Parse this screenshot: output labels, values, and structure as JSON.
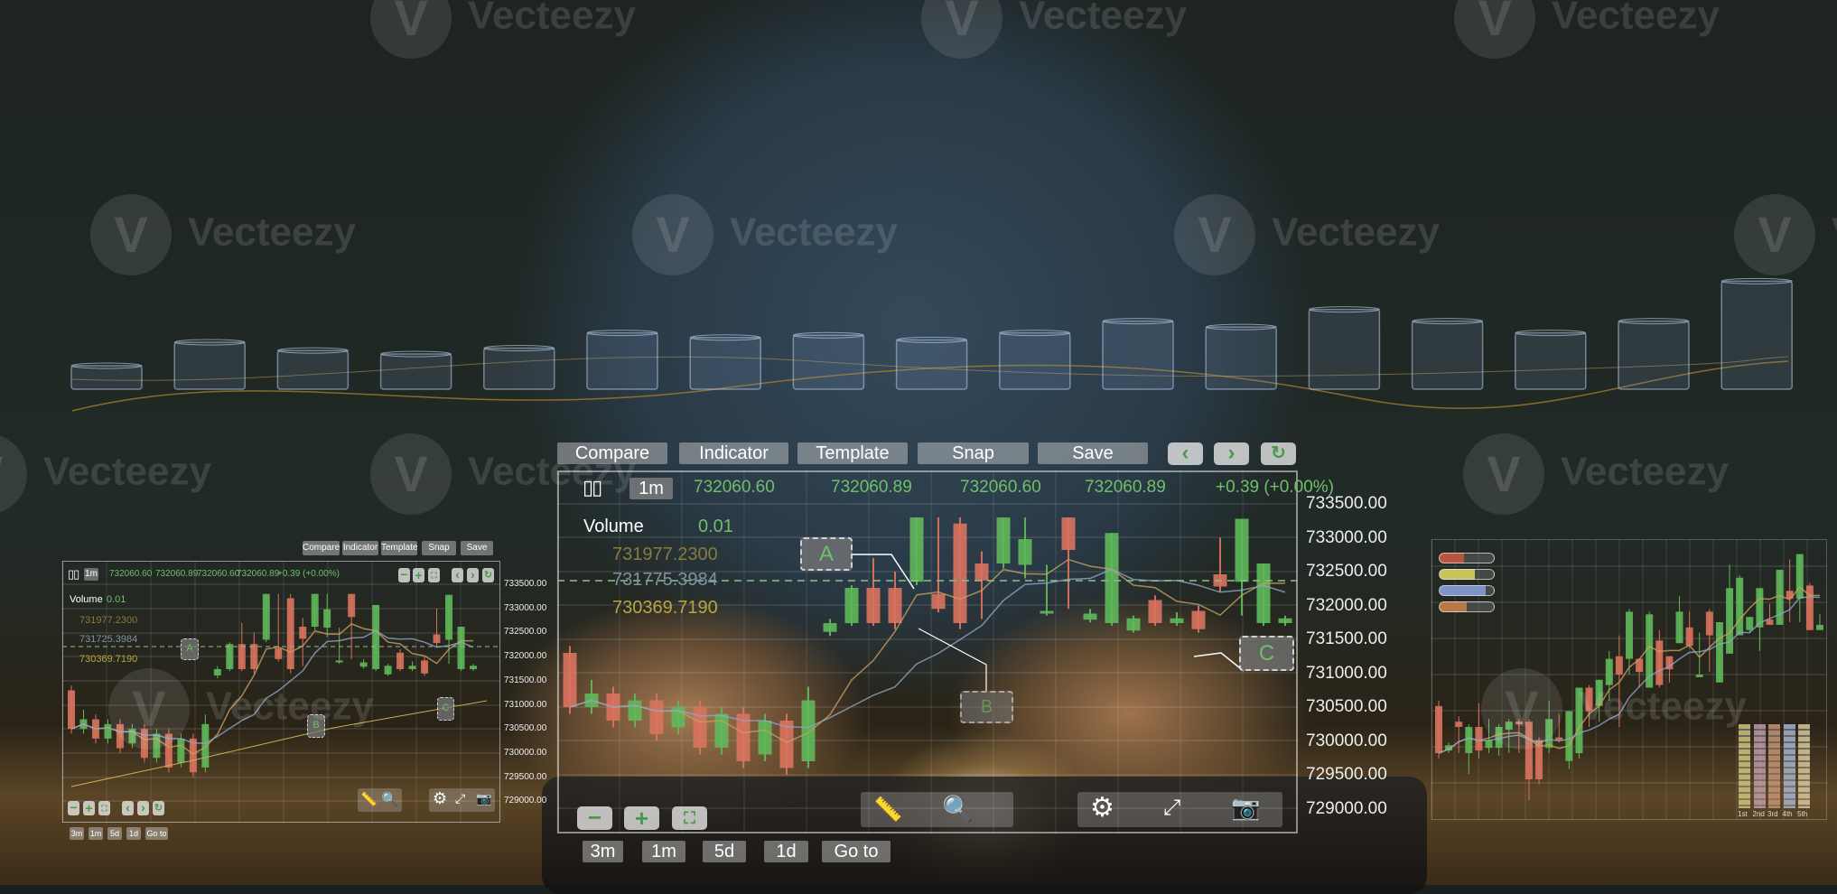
{
  "watermark": "Vecteezy",
  "colors": {
    "up": "#5fb85a",
    "down": "#d9735e",
    "ma1": "#c9a060",
    "ma2": "#8fa6c8",
    "price_text": "#6fbf6a"
  },
  "volume_cylinders": [
    20,
    40,
    33,
    30,
    35,
    48,
    44,
    46,
    42,
    48,
    58,
    53,
    68,
    58,
    48,
    58,
    92
  ],
  "main": {
    "toolbar": [
      "Compare",
      "Indicator",
      "Template",
      "Snap",
      "Save"
    ],
    "nav": {
      "prev": "‹",
      "next": "›",
      "refresh": "↻"
    },
    "interval": "1m",
    "ohlc": [
      "732060.60",
      "732060.89",
      "732060.60",
      "732060.89",
      "+0.39 (+0.00%)"
    ],
    "volume_label": "Volume",
    "volume_value": "0.01",
    "levels": [
      "731977.2300",
      "731775.3984",
      "730369.7190"
    ],
    "markers": [
      "A",
      "B",
      "C"
    ],
    "zoom": {
      "minus": "−",
      "plus": "+",
      "fit": "⛶"
    },
    "timeframes": [
      "3m",
      "1m",
      "5d",
      "1d",
      "Go to"
    ]
  },
  "small": {
    "toolbar": [
      "Compare",
      "Indicator",
      "Template",
      "Snap",
      "Save"
    ],
    "interval": "1m",
    "ohlc": [
      "732060.60",
      "732060.89",
      "732060.60",
      "732060.89",
      "+0.39 (+0.00%)"
    ],
    "volume_label": "Volume",
    "volume_value": "0.01",
    "levels": [
      "731977.2300",
      "731725.3984",
      "730369.7190"
    ],
    "markers": [
      "A",
      "B",
      "C"
    ],
    "timeframes": [
      "3m",
      "1m",
      "5d",
      "1d",
      "Go to"
    ]
  },
  "right": {
    "rank_labels": [
      "1st",
      "2nd",
      "3rd",
      "4th",
      "5th"
    ]
  },
  "chart_data": {
    "type": "candlestick",
    "y_ticks": [
      "733500.00",
      "733000.00",
      "732500.00",
      "732000.00",
      "731500.00",
      "731000.00",
      "730500.00",
      "730000.00",
      "729500.00",
      "729000.00"
    ],
    "ylim": [
      729000,
      733500
    ],
    "candles_ohlc": [
      [
        731300,
        730500,
        731400,
        730400
      ],
      [
        730500,
        730700,
        730900,
        730400
      ],
      [
        730700,
        730300,
        730800,
        730200
      ],
      [
        730300,
        730600,
        730700,
        730200
      ],
      [
        730600,
        730100,
        730700,
        730000
      ],
      [
        730200,
        730500,
        730600,
        730100
      ],
      [
        730500,
        729900,
        730600,
        729800
      ],
      [
        729900,
        730400,
        730500,
        729800
      ],
      [
        730400,
        729700,
        730500,
        729600
      ],
      [
        729800,
        730300,
        730400,
        729700
      ],
      [
        730300,
        729600,
        730400,
        729500
      ],
      [
        729700,
        730600,
        730800,
        729600
      ],
      [
        731610,
        731740,
        731800,
        731550
      ],
      [
        731740,
        732260,
        732300,
        731700
      ],
      [
        732260,
        731740,
        732700,
        731700
      ],
      [
        732260,
        731740,
        732500,
        731650
      ],
      [
        732350,
        733300,
        733300,
        732300
      ],
      [
        732170,
        731950,
        733300,
        731900
      ],
      [
        733210,
        731740,
        733300,
        731650
      ],
      [
        732620,
        732370,
        732800,
        731800
      ],
      [
        732620,
        733300,
        733300,
        732550
      ],
      [
        732600,
        732980,
        733300,
        732400
      ],
      [
        731880,
        731920,
        732600,
        731850
      ],
      [
        733300,
        732820,
        733300,
        731950
      ],
      [
        731790,
        731880,
        731950,
        731750
      ],
      [
        731740,
        733070,
        733070,
        731700
      ],
      [
        731630,
        731810,
        731850,
        731600
      ],
      [
        732080,
        731740,
        732150,
        731700
      ],
      [
        731740,
        731810,
        731900,
        731700
      ],
      [
        731920,
        731650,
        732000,
        731600
      ],
      [
        732460,
        732280,
        733000,
        732200
      ],
      [
        732350,
        733280,
        733280,
        731850
      ],
      [
        731740,
        732620,
        732620,
        731700
      ],
      [
        731740,
        731810,
        731850,
        731700
      ]
    ]
  },
  "right_chart": {
    "candles": [
      [
        38,
        20,
        40,
        18
      ],
      [
        21,
        23,
        24,
        20
      ],
      [
        32,
        30,
        34,
        20
      ],
      [
        20,
        30,
        31,
        12
      ],
      [
        30,
        21,
        39,
        18
      ],
      [
        22,
        25,
        33,
        20
      ],
      [
        22,
        30,
        31,
        19
      ],
      [
        29,
        32,
        33,
        20
      ],
      [
        32,
        31,
        33,
        20
      ],
      [
        32,
        10,
        33,
        2
      ],
      [
        25,
        10,
        26,
        8
      ],
      [
        22,
        33,
        40,
        20
      ],
      [
        26,
        25,
        35,
        24
      ],
      [
        17,
        36,
        36,
        14
      ],
      [
        20,
        45,
        45,
        18
      ],
      [
        45,
        36,
        46,
        30
      ],
      [
        38,
        48,
        48,
        32
      ],
      [
        46,
        56,
        59,
        40
      ],
      [
        57,
        50,
        65,
        30
      ],
      [
        56,
        74,
        75,
        50
      ],
      [
        56,
        51,
        56,
        45
      ],
      [
        45,
        73,
        74,
        45
      ],
      [
        63,
        46,
        67,
        45
      ],
      [
        57,
        52,
        57,
        47
      ],
      [
        62,
        74,
        80,
        62
      ],
      [
        68,
        61,
        74,
        60
      ],
      [
        49,
        50,
        66,
        49
      ],
      [
        74,
        65,
        75,
        51
      ],
      [
        47,
        70,
        70,
        47
      ],
      [
        58,
        83,
        92,
        58
      ],
      [
        65,
        87,
        88,
        65
      ],
      [
        67,
        72,
        72,
        66
      ],
      [
        68,
        83,
        83,
        59
      ],
      [
        71,
        69,
        77,
        69
      ],
      [
        69,
        90,
        90,
        69
      ],
      [
        82,
        79,
        94,
        70
      ],
      [
        79,
        96,
        96,
        70
      ],
      [
        84,
        67,
        85,
        67
      ],
      [
        67,
        69,
        73,
        67
      ]
    ]
  }
}
